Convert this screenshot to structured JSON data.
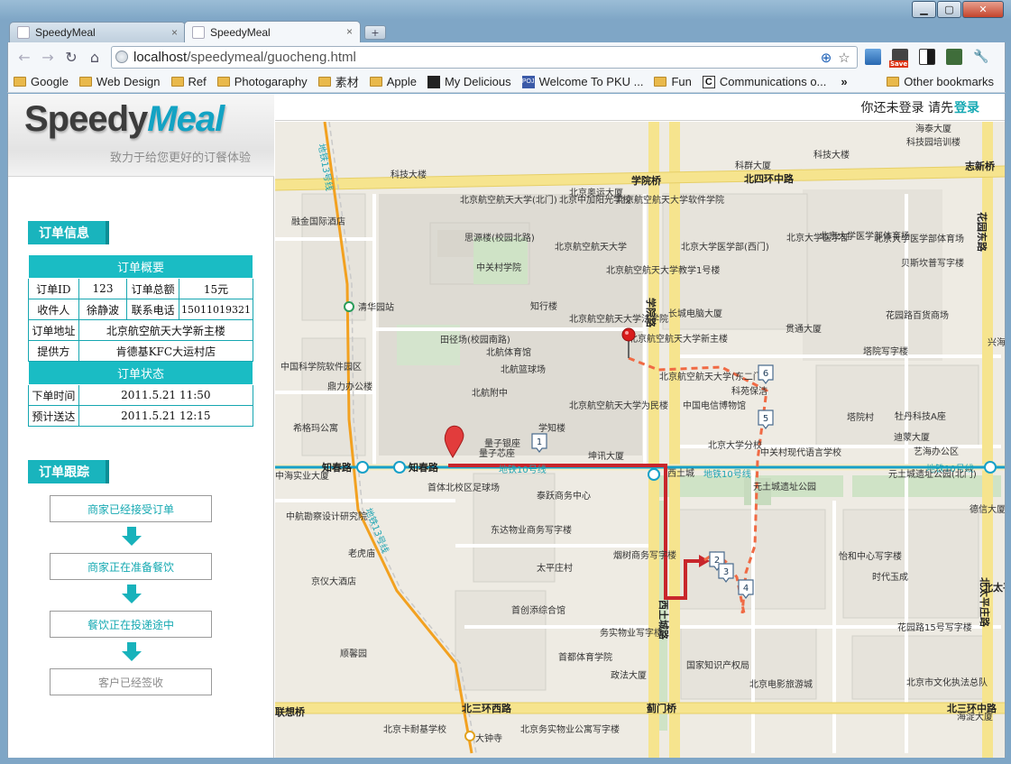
{
  "browser": {
    "tabs": [
      {
        "title": "SpeedyMeal",
        "active": false
      },
      {
        "title": "SpeedyMeal",
        "active": true
      }
    ],
    "url_host": "localhost",
    "url_path": "/speedymeal/guocheng.html",
    "bookmarks": [
      {
        "label": "Google",
        "icon": "folder-icon"
      },
      {
        "label": "Web Design",
        "icon": "folder-icon"
      },
      {
        "label": "Ref",
        "icon": "folder-icon"
      },
      {
        "label": "Photogaraphy",
        "icon": "folder-icon"
      },
      {
        "label": "素材",
        "icon": "folder-icon"
      },
      {
        "label": "Apple",
        "icon": "folder-icon"
      },
      {
        "label": "My Delicious",
        "icon": "delicious-icon"
      },
      {
        "label": "Welcome To PKU ...",
        "icon": "poj-icon"
      },
      {
        "label": "Fun",
        "icon": "folder-icon"
      },
      {
        "label": "Communications o...",
        "icon": "c-icon"
      }
    ],
    "bookmarks_more": "»",
    "other_bookmarks": "Other bookmarks",
    "save_ext_label": "Save"
  },
  "sidebar": {
    "logo_part1": "Speedy",
    "logo_part2": "Meal",
    "slogan": "致力于给您更好的订餐体验",
    "order_info_title": "订单信息",
    "summary_head": "订单概要",
    "order_id_label": "订单ID",
    "order_id": "123",
    "total_label": "订单总额",
    "total": "15元",
    "recipient_label": "收件人",
    "recipient": "徐静波",
    "phone_label": "联系电话",
    "phone": "15011019321",
    "address_label": "订单地址",
    "address": "北京航空航天大学新主楼",
    "provider_label": "提供方",
    "provider": "肯德基KFC大运村店",
    "status_head": "订单状态",
    "order_time_label": "下单时间",
    "order_time": "2011.5.21 11:50",
    "eta_label": "预计送达",
    "eta": "2011.5.21 12:15",
    "tracking_title": "订单跟踪",
    "steps": [
      {
        "label": "商家已经接受订单",
        "done": true
      },
      {
        "label": "商家正在准备餐饮",
        "done": true
      },
      {
        "label": "餐饮正在投递途中",
        "done": true
      },
      {
        "label": "客户已经签收",
        "done": false
      }
    ]
  },
  "topbar": {
    "not_logged": "你还未登录 请先",
    "login": "登录"
  },
  "map": {
    "colors": {
      "route": "#c8262c",
      "dashed": "#f06a44",
      "subway13": "#f2a120",
      "subway10": "#16a0c8"
    },
    "road_labels": [
      "学院桥",
      "北四环中路",
      "志新桥",
      "知春路",
      "知春路",
      "北三环西路",
      "蓟门桥",
      "北三环中路",
      "联想桥",
      "地铁10号线",
      "地铁10号线",
      "地铁10号线",
      "地铁13号线",
      "地铁13号线",
      "学院路",
      "西土城路",
      "北太平庄路",
      "花园东路",
      "北太平庄"
    ],
    "places": [
      "北京航空航天大学(北门)",
      "北京中加阳光学校",
      "北京航空航天大学软件学院",
      "思源楼(校园北路)",
      "北京航空航天大学",
      "北京大学医学部(西门)",
      "北京大学医学部",
      "北京大学医学部体育场",
      "北京航空航天大学教学1号楼",
      "知行楼",
      "长城电脑大厦",
      "北京航空航天大学法学院",
      "北京航空航天大学新主楼",
      "田径场(校园南路)",
      "北航体育馆",
      "北航篮球场",
      "北京航空航天大学(东二门)",
      "科苑保洁",
      "北航附中",
      "北京航空航天大学为民楼",
      "中国电信博物馆",
      "学知楼",
      "量子银座",
      "量子芯座",
      "坤讯大厦",
      "西土城",
      "首体北校区足球场",
      "泰跃商务中心",
      "东达物业商务写字楼",
      "烟树商务写字楼",
      "太平庄村",
      "首创添综合馆",
      "务实物业写字楼",
      "首都体育学院",
      "政法大厦",
      "国家知识产权局",
      "北京电影旅游城",
      "北京务实物业公寓写字楼",
      "北京卡耐基学校",
      "大钟寺",
      "清华园站",
      "中国科学院软件园区",
      "鼎力办公楼",
      "希格玛公寓",
      "中海实业大厦",
      "中航勘察设计研究院",
      "老虎庙",
      "京仪大酒店",
      "顺馨园",
      "科技大楼",
      "中关村学院",
      "北京奥运大厦",
      "科群大厦",
      "融金国际酒店",
      "科技大楼",
      "海泰大厦",
      "科技园培训楼",
      "北京大学医学部体育场",
      "贝斯坎普写字楼",
      "花园路百货商场",
      "贯通大厦",
      "塔院写字楼",
      "塔院村",
      "牡丹科技A座",
      "迪蒙大厦",
      "艺海办公区",
      "北京大学分校",
      "中关村现代语言学校",
      "元土城遗址公园(北门)",
      "元土城遗址公园",
      "德信大厦",
      "怡和中心写字楼",
      "时代玉成",
      "花园路15号写字楼",
      "北京市文化执法总队",
      "海淀大厦",
      "兴海"
    ],
    "markers": [
      "1",
      "2",
      "3",
      "4",
      "5",
      "6"
    ]
  }
}
